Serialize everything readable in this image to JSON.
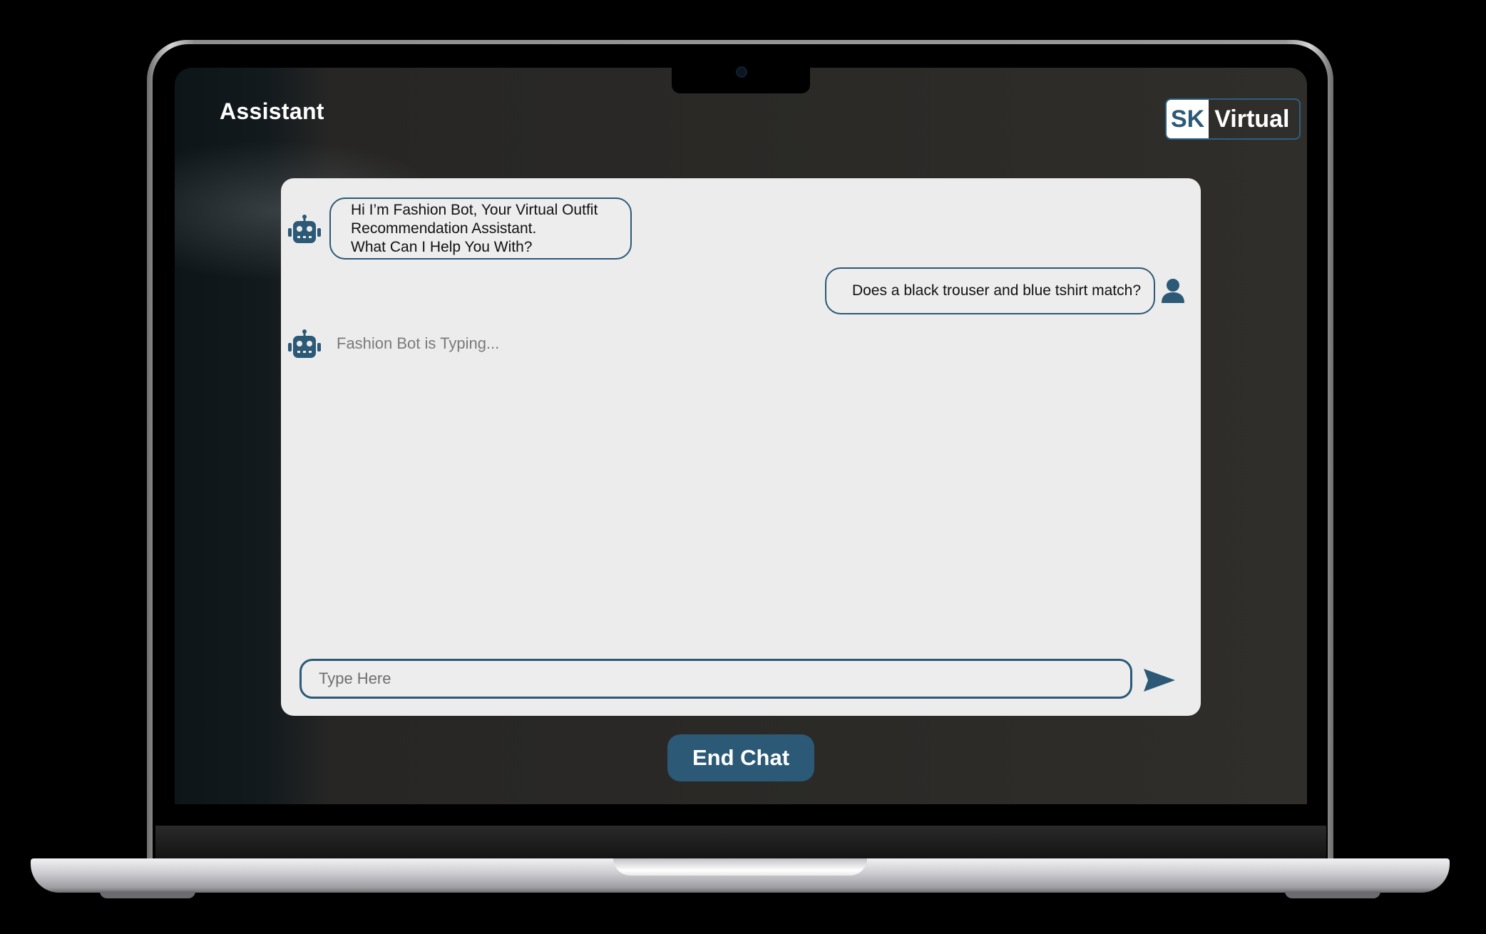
{
  "app": {
    "title": "Assistant",
    "logo": {
      "mark": "SK",
      "word": "Virtual"
    }
  },
  "chat": {
    "messages": [
      {
        "sender": "bot",
        "icon": "robot-icon",
        "lines": [
          "Hi I’m Fashion Bot, Your Virtual Outfit",
          "Recommendation Assistant.",
          "What Can I Help You With?"
        ]
      },
      {
        "sender": "user",
        "icon": "user-icon",
        "text": "Does a black trouser and blue tshirt match?"
      }
    ],
    "typing_indicator": "Fashion Bot is Typing...",
    "input": {
      "placeholder": "Type Here",
      "value": ""
    },
    "send_icon": "send-arrow-icon"
  },
  "actions": {
    "end_chat_label": "End Chat"
  },
  "colors": {
    "accent": "#2b5976",
    "panel": "#ececec"
  }
}
